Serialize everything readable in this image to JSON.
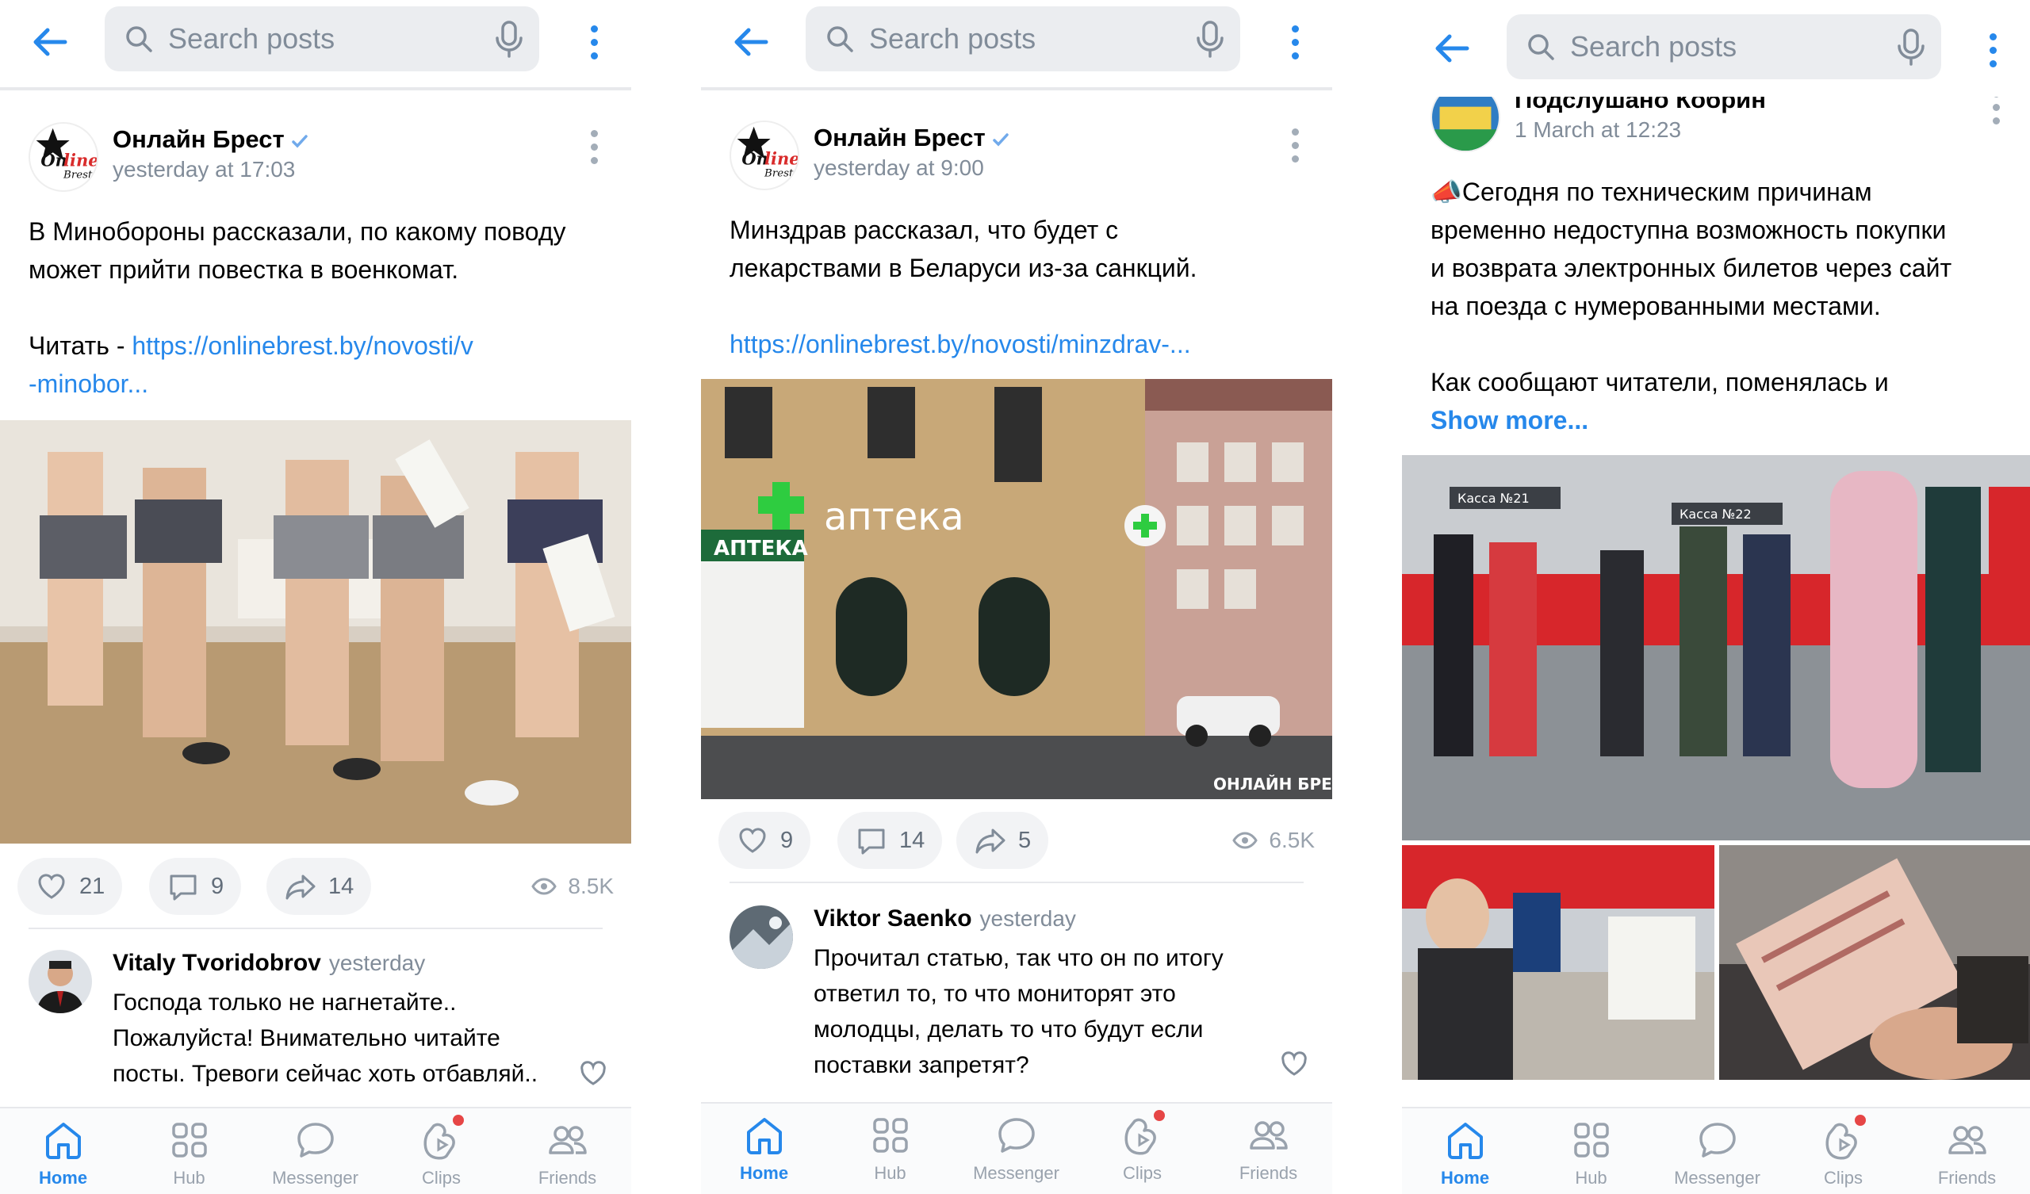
{
  "search": {
    "placeholder": "Search posts"
  },
  "nav": {
    "home": "Home",
    "hub": "Hub",
    "messenger": "Messenger",
    "clips": "Clips",
    "friends": "Friends"
  },
  "colors": {
    "accent": "#2688eb",
    "badge": "#e64646",
    "muted": "#818c99"
  },
  "panels": [
    {
      "post": {
        "author": "Онлайн Брест",
        "time": "yesterday at 17:03",
        "lines": [
          "В Минобороны рассказали, по какому поводу",
          "может прийти повестка в военкомат.",
          "",
          "Читать - "
        ],
        "link1": "https://onlinebrest.by/novosti/v",
        "link2": "-minobor...",
        "likes": "21",
        "comments": "9",
        "shares": "14",
        "views": "8.5K"
      },
      "comment": {
        "name": "Vitaly Tvoridobrov",
        "when": "yesterday",
        "lines": [
          "Господа только не нагнетайте..",
          "Пожалуйста! Внимательно читайте",
          "посты. Тревоги сейчас хоть отбавляй.."
        ]
      }
    },
    {
      "post": {
        "author": "Онлайн Брест",
        "time": "yesterday at 9:00",
        "lines": [
          "Минздрав рассказал, что будет с",
          "лекарствами в Беларуси из-за санкций."
        ],
        "link1": "https://onlinebrest.by/novosti/minzdrav-...",
        "photo_texts": {
          "sign_big": "аптека",
          "sign_small": "АПТЕКА",
          "watermark": "ОНЛАЙН БРЕСТ"
        },
        "likes": "9",
        "comments": "14",
        "shares": "5",
        "views": "6.5K"
      },
      "comment": {
        "name": "Viktor Saenko",
        "when": "yesterday",
        "lines": [
          "Прочитал статью, так что он по итогу",
          "ответил то, то что мониторят это",
          "молодцы, делать то что будут если",
          "поставки запретят?"
        ]
      }
    },
    {
      "post": {
        "author": "Подслушано Кобрин",
        "time": "1 March at 12:23",
        "lines": [
          "📣Сегодня по техническим причинам",
          "временно недоступна возможность покупки",
          "и возврата электронных билетов через сайт",
          "на поезда с нумерованными местами.",
          "",
          "Как сообщают читатели, поменялась и"
        ],
        "show_more": "Show more...",
        "photo_texts": {
          "kassa1": "Касса №21",
          "kassa2": "Касса №22"
        }
      }
    }
  ]
}
